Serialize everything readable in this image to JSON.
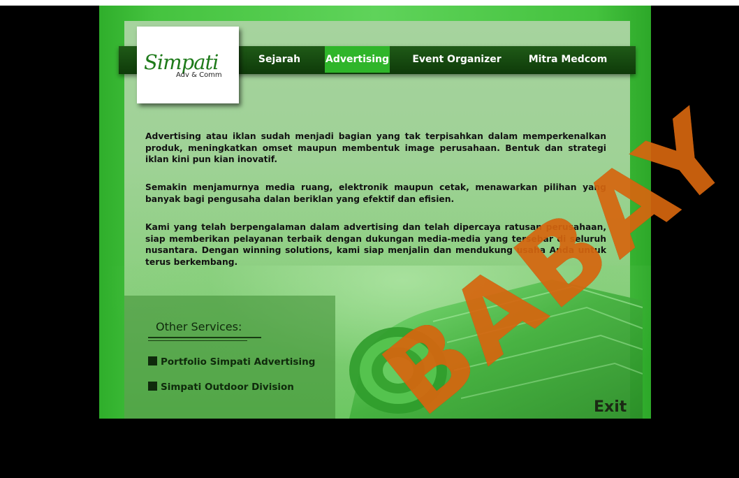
{
  "logo": {
    "script": "Simpati",
    "sub": "Adv & Comm"
  },
  "nav": {
    "items": [
      {
        "label": "Sejarah"
      },
      {
        "label": "Advertising"
      },
      {
        "label": "Event Organizer"
      },
      {
        "label": "Mitra Medcom"
      }
    ],
    "active": "Advertising"
  },
  "content": {
    "paragraphs": [
      "Advertising atau iklan sudah menjadi bagian yang tak terpisahkan dalam memperkenalkan produk, meningkatkan omset maupun membentuk image perusahaan. Bentuk dan strategi iklan kini pun kian inovatif.",
      "Semakin menjamurnya media ruang, elektronik maupun cetak, menawarkan pilihan yang banyak bagi pengusaha dalan beriklan yang efektif dan efisien.",
      "Kami yang telah berpengalaman dalam advertising dan telah dipercaya ratusan perusahaan, siap memberikan pelayanan terbaik dengan dukungan media-media yang tersebar di seluruh nusantara. Dengan winning solutions, kami siap menjalin dan mendukung usaha Anda untuk terus berkembang."
    ]
  },
  "services": {
    "title": "Other Services:",
    "items": [
      {
        "label": "Portfolio Simpati Advertising"
      },
      {
        "label": "Simpati Outdoor Division"
      }
    ]
  },
  "exit_label": "Exit",
  "watermark": "BABAY",
  "colors": {
    "active_nav": "#2fb52a",
    "nav_bar": "#0e3a09",
    "panel": "#9fd296",
    "watermark": "#d6660f"
  }
}
